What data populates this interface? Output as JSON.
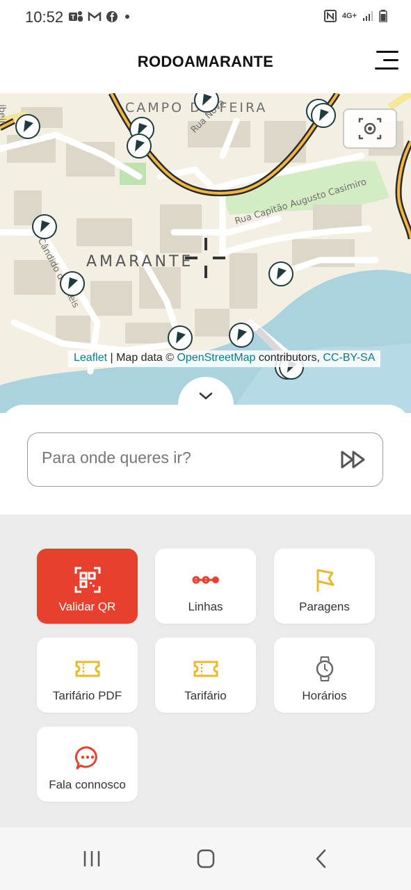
{
  "status_bar": {
    "time": "10:52",
    "left_icons": [
      "teams-icon",
      "gmail-icon",
      "facebook-icon",
      "dot-icon"
    ],
    "right_icons": [
      "nfc-icon",
      "4g-icon",
      "signal-icon",
      "battery-icon"
    ],
    "network": "4G+"
  },
  "header": {
    "title": "RODOAMARANTE",
    "menu_icon": "hamburger-menu-icon"
  },
  "map": {
    "labels": {
      "campo_da_feira": "CAMPO DA FEIRA",
      "amarante": "AMARANTE",
      "rua_nova": "Rua Nova",
      "rua_capitao": "Rua Capitão Augusto Casimiro",
      "candido_reis": "Cândido dos Reis",
      "edge_left": "ibeir"
    },
    "attribution": {
      "leaflet": "Leaflet",
      "separator": " | Map data © ",
      "osm": "OpenStreetMap",
      "contributors": " contributors, ",
      "license": "CC-BY-SA"
    },
    "icons": {
      "locate": "locate-icon",
      "crosshair": "crosshair-icon",
      "collapse": "chevron-down-icon",
      "stop": "flag-marker-icon"
    }
  },
  "search": {
    "placeholder": "Para onde queres ir?",
    "submit_icon": "fast-forward-icon"
  },
  "tiles": [
    {
      "label": "Validar QR",
      "icon": "qr-scan-icon"
    },
    {
      "label": "Linhas",
      "icon": "route-line-icon"
    },
    {
      "label": "Paragens",
      "icon": "flag-icon"
    },
    {
      "label": "Tarifário PDF",
      "icon": "ticket-icon"
    },
    {
      "label": "Tarifário",
      "icon": "ticket-icon"
    },
    {
      "label": "Horários",
      "icon": "watch-icon"
    },
    {
      "label": "Fala connosco",
      "icon": "chat-bubble-icon"
    }
  ],
  "nav_bar": {
    "recents_icon": "recents-icon",
    "home_icon": "home-icon",
    "back_icon": "back-icon"
  },
  "colors": {
    "accent": "#e8402e",
    "icon_yellow": "#e8b92a",
    "marker_dark": "#1f3b3d",
    "link": "#0b7a8a"
  }
}
